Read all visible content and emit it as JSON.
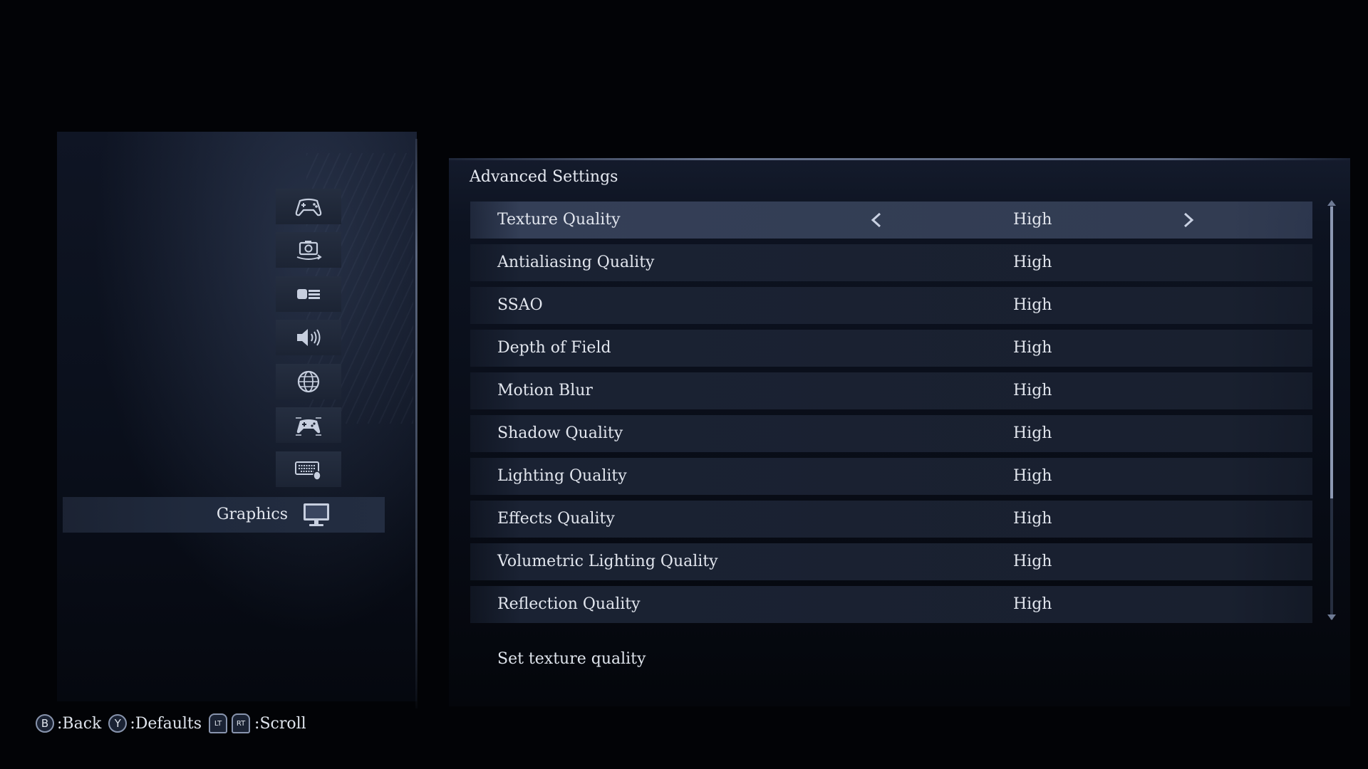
{
  "menu": {
    "categories": [
      {
        "icon": "gamepad-icon"
      },
      {
        "icon": "camera-icon"
      },
      {
        "icon": "display-layout-icon"
      },
      {
        "icon": "speaker-icon"
      },
      {
        "icon": "globe-icon"
      },
      {
        "icon": "controller-mapping-icon"
      },
      {
        "icon": "keyboard-mouse-icon"
      }
    ],
    "selected": {
      "label": "Graphics",
      "icon": "monitor-icon"
    }
  },
  "settings": {
    "section_title": "Advanced Settings",
    "rows": [
      {
        "label": "Texture Quality",
        "value": "High"
      },
      {
        "label": "Antialiasing Quality",
        "value": "High"
      },
      {
        "label": "SSAO",
        "value": "High"
      },
      {
        "label": "Depth of Field",
        "value": "High"
      },
      {
        "label": "Motion Blur",
        "value": "High"
      },
      {
        "label": "Shadow Quality",
        "value": "High"
      },
      {
        "label": "Lighting Quality",
        "value": "High"
      },
      {
        "label": "Effects Quality",
        "value": "High"
      },
      {
        "label": "Volumetric Lighting Quality",
        "value": "High"
      },
      {
        "label": "Reflection Quality",
        "value": "High"
      }
    ],
    "selected_index": 0,
    "description": "Set texture quality"
  },
  "hints": {
    "back": {
      "button": "B",
      "label": ":Back"
    },
    "defaults": {
      "button": "Y",
      "label": ":Defaults"
    },
    "scroll": {
      "button_left": "LT",
      "button_right": "RT",
      "label": ":Scroll"
    }
  },
  "colors": {
    "background": "#020306",
    "row": "#1a2233",
    "row_selected": "#343f57",
    "text": "#e2e6ee",
    "accent": "#8c98b2"
  }
}
